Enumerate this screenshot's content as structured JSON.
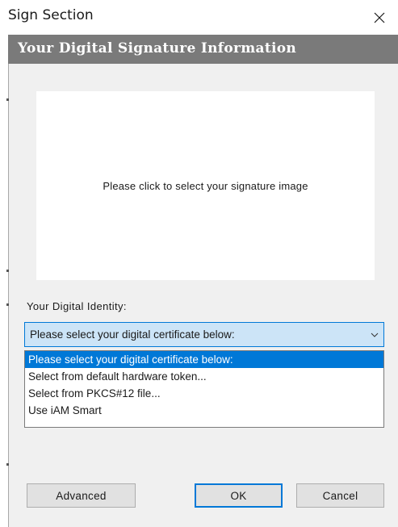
{
  "window": {
    "title": "Sign Section",
    "close_icon": "close-icon"
  },
  "header": {
    "title": "Your Digital Signature Information"
  },
  "signature_area": {
    "prompt": "Please click to select your signature image"
  },
  "identity": {
    "label": "Your Digital Identity:",
    "selected_value": "Please select your digital certificate below:",
    "options": [
      "Please select your digital certificate below:",
      "Select from default hardware token...",
      "Select from PKCS#12 file...",
      "Use iAM Smart"
    ]
  },
  "buttons": {
    "advanced": "Advanced",
    "ok": "OK",
    "cancel": "Cancel"
  },
  "colors": {
    "header_band": "#7a7a7a",
    "accent": "#0078d7",
    "select_bg": "#cce4f7",
    "panel_bg": "#f0f0f0"
  }
}
